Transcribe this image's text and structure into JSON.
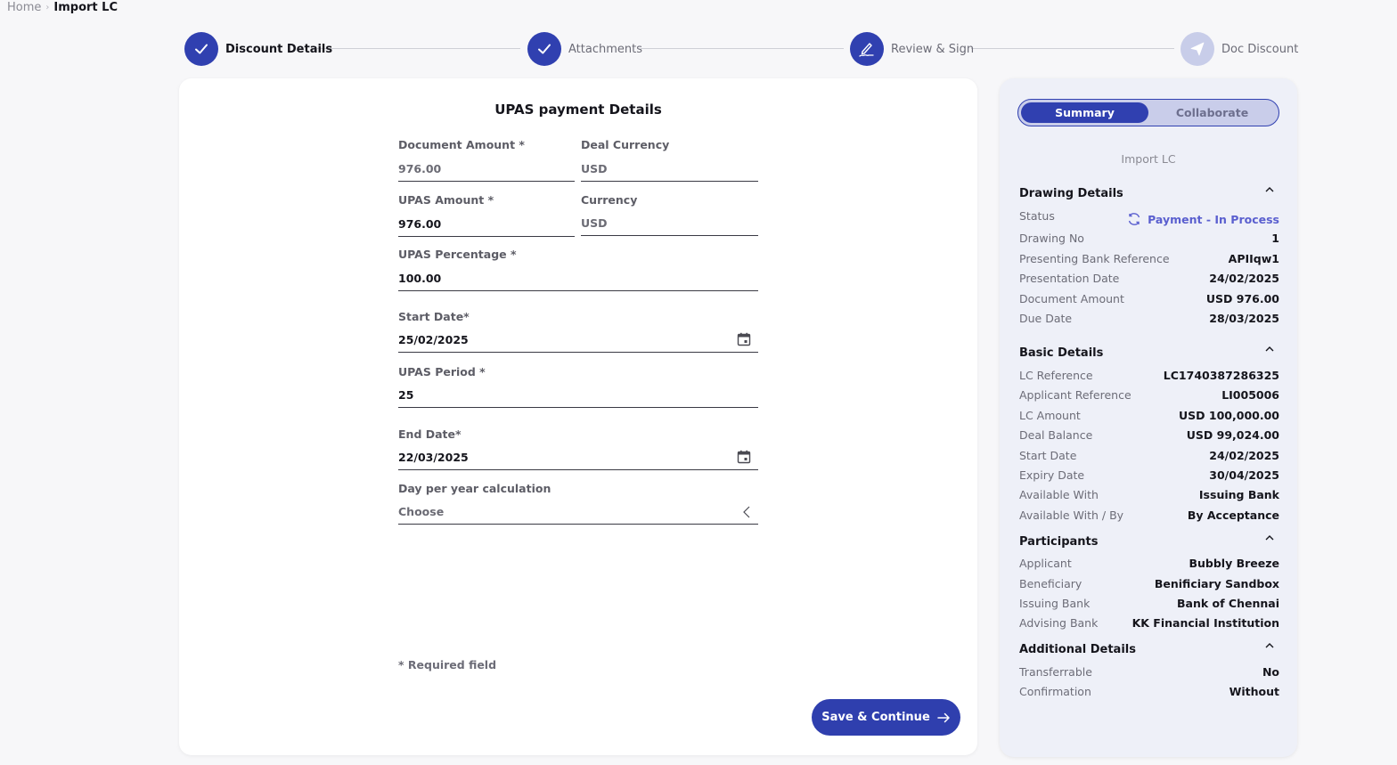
{
  "breadcrumb": {
    "home": "Home",
    "separator": "›",
    "current": "Import LC"
  },
  "stepper": [
    {
      "label": "Discount Details",
      "state": "done",
      "icon": "check-icon"
    },
    {
      "label": "Attachments",
      "state": "done",
      "icon": "check-icon"
    },
    {
      "label": "Review & Sign",
      "state": "current",
      "icon": "signature-icon"
    },
    {
      "label": "Doc Discount",
      "state": "pending",
      "icon": "paper-plane-icon"
    }
  ],
  "form": {
    "title": "UPAS payment Details",
    "document_amount": {
      "label": "Document Amount *",
      "value": "976.00"
    },
    "deal_currency": {
      "label": "Deal Currency",
      "value": "USD"
    },
    "upas_amount": {
      "label": "UPAS Amount *",
      "value": "976.00"
    },
    "currency": {
      "label": "Currency",
      "value": "USD"
    },
    "upas_percentage": {
      "label": "UPAS Percentage *",
      "value": "100.00"
    },
    "start_date": {
      "label": "Start Date*",
      "value": "25/02/2025"
    },
    "upas_period": {
      "label": "UPAS Period *",
      "value": "25"
    },
    "end_date": {
      "label": "End Date*",
      "value": "22/03/2025"
    },
    "day_per_year": {
      "label": "Day per year calculation",
      "value": "Choose"
    },
    "required_note": "* Required field",
    "save_label": "Save & Continue"
  },
  "sidebar": {
    "tabs": {
      "summary": "Summary",
      "collaborate": "Collaborate"
    },
    "subtitle": "Import LC",
    "drawing": {
      "title": "Drawing Details",
      "status_label": "Status",
      "status_value": "Payment - In Process",
      "rows": [
        {
          "k": "Drawing No",
          "v": "1"
        },
        {
          "k": "Presenting Bank Reference",
          "v": "APIIqw1"
        },
        {
          "k": "Presentation Date",
          "v": "24/02/2025"
        },
        {
          "k": "Document Amount",
          "v": "USD 976.00"
        },
        {
          "k": "Due Date",
          "v": "28/03/2025"
        }
      ]
    },
    "basic": {
      "title": "Basic Details",
      "rows": [
        {
          "k": "LC Reference",
          "v": "LC1740387286325"
        },
        {
          "k": "Applicant Reference",
          "v": "LI005006"
        },
        {
          "k": "LC Amount",
          "v": "USD 100,000.00"
        },
        {
          "k": "Deal Balance",
          "v": "USD 99,024.00"
        },
        {
          "k": "Start Date",
          "v": "24/02/2025"
        },
        {
          "k": "Expiry Date",
          "v": "30/04/2025"
        },
        {
          "k": "Available With",
          "v": "Issuing Bank"
        },
        {
          "k": "Available With / By",
          "v": "By Acceptance"
        }
      ]
    },
    "participants": {
      "title": "Participants",
      "rows": [
        {
          "k": "Applicant",
          "v": "Bubbly Breeze"
        },
        {
          "k": "Beneficiary",
          "v": "Benificiary Sandbox"
        },
        {
          "k": "Issuing Bank",
          "v": "Bank of Chennai"
        },
        {
          "k": "Advising Bank",
          "v": "KK Financial Institution"
        }
      ]
    },
    "additional": {
      "title": "Additional Details",
      "rows": [
        {
          "k": "Transferrable",
          "v": "No"
        },
        {
          "k": "Confirmation",
          "v": "Without"
        }
      ]
    }
  },
  "colors": {
    "primary": "#3040b0",
    "pending": "#c8cde9",
    "status": "#5a5fcf",
    "panel": "#eef0f8"
  }
}
